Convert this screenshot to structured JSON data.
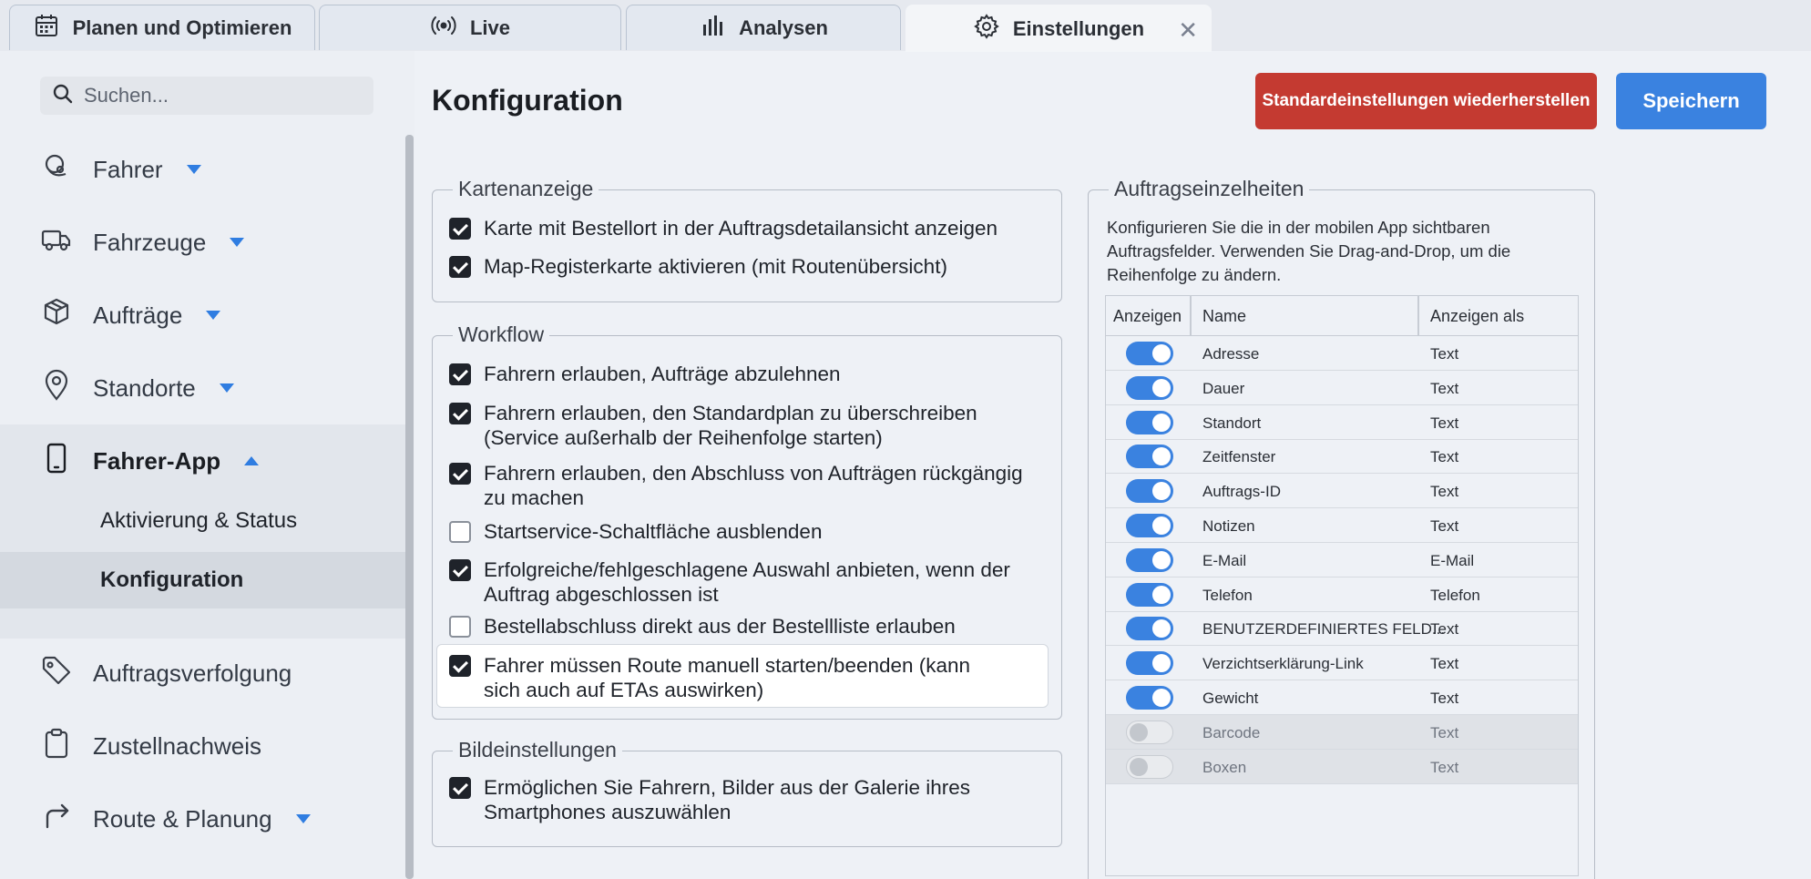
{
  "tabs": [
    {
      "label": "Planen und Optimieren",
      "icon": "calendar-icon"
    },
    {
      "label": "Live",
      "icon": "broadcast-icon"
    },
    {
      "label": "Analysen",
      "icon": "bar-chart-icon"
    },
    {
      "label": "Einstellungen",
      "icon": "gear-icon",
      "active": true,
      "close": "✕"
    }
  ],
  "sidebar": {
    "search_placeholder": "Suchen...",
    "items": [
      {
        "label": "Fahrer",
        "icon": "driver-icon"
      },
      {
        "label": "Fahrzeuge",
        "icon": "truck-icon"
      },
      {
        "label": "Aufträge",
        "icon": "box-icon"
      },
      {
        "label": "Standorte",
        "icon": "location-pin-icon"
      },
      {
        "label": "Fahrer-App",
        "icon": "smartphone-icon"
      },
      {
        "label": "Auftragsverfolgung",
        "icon": "tag-icon"
      },
      {
        "label": "Zustellnachweis",
        "icon": "clipboard-icon"
      },
      {
        "label": "Route & Planung",
        "icon": "route-arrow-icon"
      }
    ],
    "subitems": [
      {
        "label": "Aktivierung & Status"
      },
      {
        "label": "Konfiguration",
        "selected": true
      }
    ]
  },
  "main": {
    "title": "Konfiguration",
    "reset_label": "Standardeinstellungen wiederherstellen",
    "save_label": "Speichern"
  },
  "kartenanzeige": {
    "legend": "Kartenanzeige",
    "options": [
      {
        "label": "Karte mit Bestellort in der Auftragsdetailansicht anzeigen",
        "checked": true
      },
      {
        "label": "Map-Registerkarte aktivieren (mit Routenübersicht)",
        "checked": true
      }
    ]
  },
  "workflow": {
    "legend": "Workflow",
    "options": [
      {
        "label": "Fahrern erlauben, Aufträge abzulehnen",
        "checked": true
      },
      {
        "label": "Fahrern erlauben, den Standardplan zu überschreiben (Service außerhalb der Reihenfolge starten)",
        "checked": true
      },
      {
        "label": "Fahrern erlauben, den Abschluss von Aufträgen rückgängig zu machen",
        "checked": true
      },
      {
        "label": "Startservice-Schaltfläche ausblenden",
        "checked": false
      },
      {
        "label": "Erfolgreiche/fehlgeschlagene Auswahl anbieten, wenn der Auftrag abgeschlossen ist",
        "checked": true
      },
      {
        "label": "Bestellabschluss direkt aus der Bestellliste erlauben",
        "checked": false
      },
      {
        "label": "Fahrer müssen Route manuell starten/beenden (kann sich auch auf ETAs auswirken)",
        "checked": true
      }
    ]
  },
  "bildeinstellungen": {
    "legend": "Bildeinstellungen",
    "options": [
      {
        "label": "Ermöglichen Sie Fahrern, Bilder aus der Galerie ihres Smartphones auszuwählen",
        "checked": true
      }
    ]
  },
  "auftragsdetails": {
    "legend": "Auftragseinzelheiten",
    "description": "Konfigurieren Sie die in der mobilen App sichtbaren Auftragsfelder. Verwenden Sie Drag-and-Drop, um die Reihenfolge zu ändern.",
    "columns": [
      "Anzeigen",
      "Name",
      "Anzeigen als"
    ],
    "rows": [
      {
        "name": "Adresse",
        "as": "Text",
        "on": true
      },
      {
        "name": "Dauer",
        "as": "Text",
        "on": true
      },
      {
        "name": "Standort",
        "as": "Text",
        "on": true
      },
      {
        "name": "Zeitfenster",
        "as": "Text",
        "on": true
      },
      {
        "name": "Auftrags-ID",
        "as": "Text",
        "on": true
      },
      {
        "name": "Notizen",
        "as": "Text",
        "on": true
      },
      {
        "name": "E-Mail",
        "as": "E-Mail",
        "on": true
      },
      {
        "name": "Telefon",
        "as": "Telefon",
        "on": true
      },
      {
        "name": "BENUTZERDEFINIERTES FELD...",
        "as": "Text",
        "on": true
      },
      {
        "name": "Verzichtserklärung-Link",
        "as": "Text",
        "on": true
      },
      {
        "name": "Gewicht",
        "as": "Text",
        "on": true
      },
      {
        "name": "Barcode",
        "as": "Text",
        "on": false
      },
      {
        "name": "Boxen",
        "as": "Text",
        "on": false
      }
    ]
  },
  "colors": {
    "accent": "#3a82e0",
    "danger": "#c43a31"
  }
}
